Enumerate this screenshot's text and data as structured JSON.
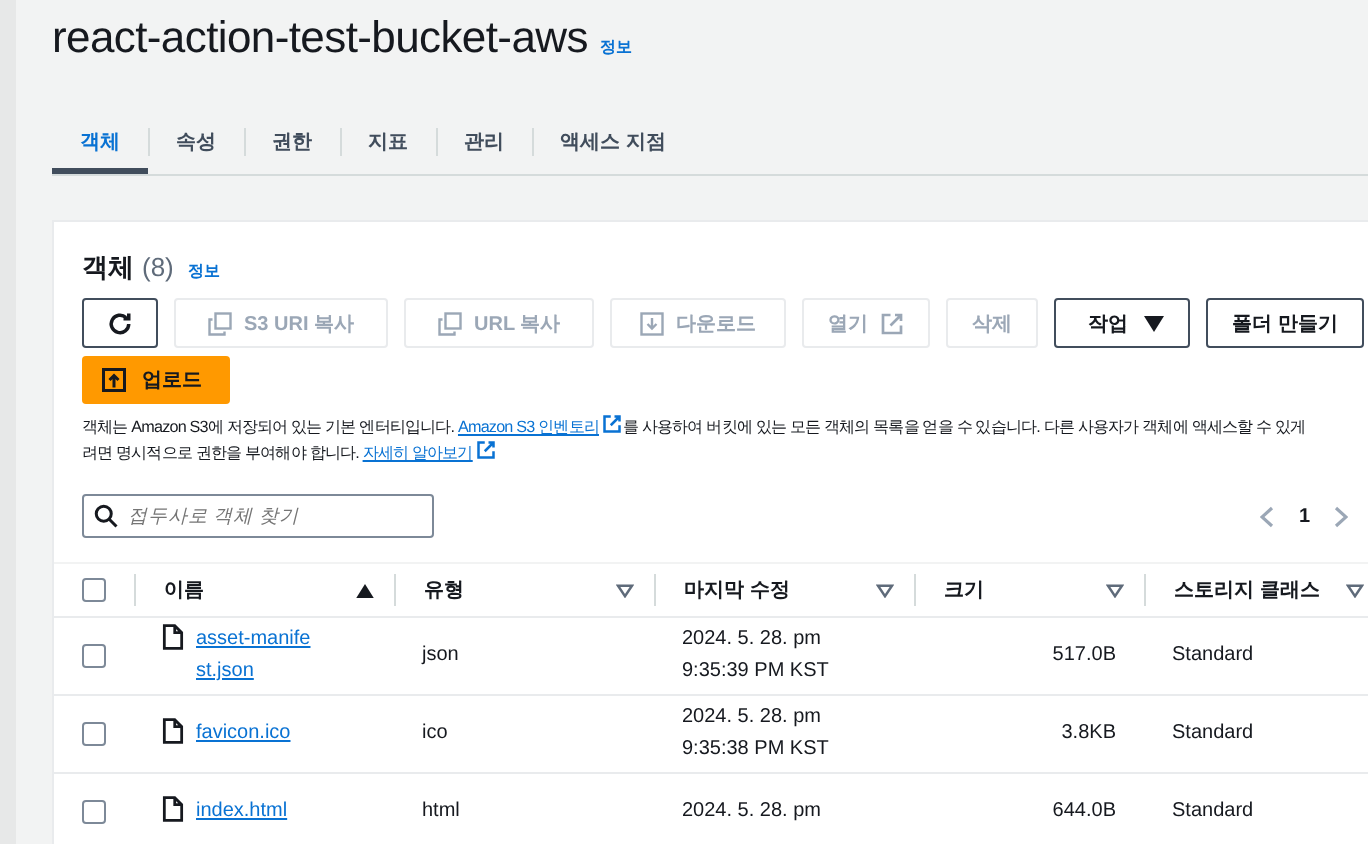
{
  "bucket": {
    "title": "react-action-test-bucket-aws",
    "info_link": "정보"
  },
  "tabs": [
    {
      "label": "객체",
      "selected": true
    },
    {
      "label": "속성",
      "selected": false
    },
    {
      "label": "권한",
      "selected": false
    },
    {
      "label": "지표",
      "selected": false
    },
    {
      "label": "관리",
      "selected": false
    },
    {
      "label": "액세스 지점",
      "selected": false
    }
  ],
  "objects_panel": {
    "heading": "객체",
    "count": "(8)",
    "info_link": "정보",
    "toolbar": [
      {
        "kind": "refresh",
        "disabled": false
      },
      {
        "kind": "copy",
        "label": "S3 URI 복사",
        "disabled": true
      },
      {
        "kind": "copy",
        "label": "URL 복사",
        "disabled": true
      },
      {
        "kind": "download",
        "label": "다운로드",
        "disabled": true
      },
      {
        "kind": "external",
        "label": "열기",
        "disabled": true
      },
      {
        "kind": "plain",
        "label": "삭제",
        "disabled": true
      },
      {
        "kind": "dropdown",
        "label": "작업",
        "disabled": false
      },
      {
        "kind": "plain",
        "label": "폴더 만들기",
        "disabled": false
      }
    ],
    "upload_button": "업로드",
    "description_lines": [
      [
        {
          "kind": "text",
          "text": "객체는 Amazon S3에 저장되어 있는 기본 엔터티입니다. "
        },
        {
          "kind": "link",
          "text": "Amazon S3 인벤토리"
        },
        {
          "kind": "text",
          "text": "를 사용하여 버킷에 있는 모든 객체의 목록을 얻을 수 있습니다. 다른 사용자가 객체에 액세스할 수 있게"
        }
      ],
      [
        {
          "kind": "text",
          "text": "려면 명시적으로 권한을 부여해야 합니다. "
        },
        {
          "kind": "link",
          "text": "자세히 알아보기"
        }
      ]
    ],
    "search": {
      "placeholder": "접두사로 객체 찾기"
    },
    "pagination": {
      "page": "1"
    },
    "table": {
      "select_all": {
        "checked": false
      },
      "columns": [
        {
          "label": "이름",
          "sorted": true
        },
        {
          "label": "유형",
          "sorted": false
        },
        {
          "label": "마지막 수정",
          "sorted": false
        },
        {
          "label": "크기",
          "sorted": false
        },
        {
          "label": "스토리지 클래스",
          "sorted": false
        }
      ],
      "rows": [
        {
          "selected": false,
          "name": "asset-manifest.json",
          "type": "json",
          "modified": [
            "2024. 5. 28. pm",
            "9:35:39 PM KST"
          ],
          "size": "517.0B",
          "storage_class": "Standard"
        },
        {
          "selected": false,
          "name": "favicon.ico",
          "type": "ico",
          "modified": [
            "2024. 5. 28. pm",
            "9:35:38 PM KST"
          ],
          "size": "3.8KB",
          "storage_class": "Standard"
        },
        {
          "selected": false,
          "name": "index.html",
          "type": "html",
          "modified": [
            "2024. 5. 28. pm"
          ],
          "size": "644.0B",
          "storage_class": "Standard"
        }
      ]
    }
  }
}
